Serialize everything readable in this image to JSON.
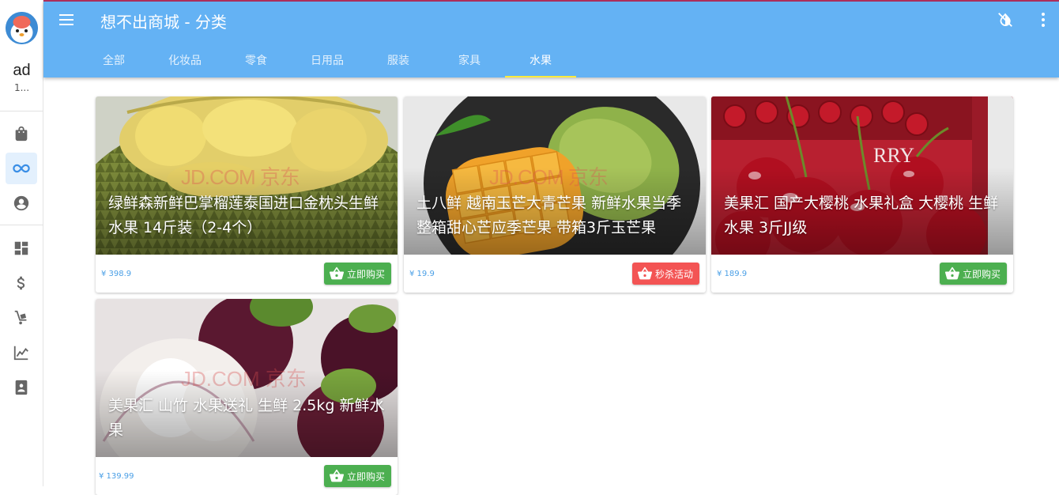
{
  "app": {
    "title": "想不出商城 - 分类"
  },
  "user": {
    "name": "ad",
    "sub": "1..."
  },
  "tabs": [
    {
      "label": "全部"
    },
    {
      "label": "化妆品"
    },
    {
      "label": "零食"
    },
    {
      "label": "日用品"
    },
    {
      "label": "服装"
    },
    {
      "label": "家具"
    },
    {
      "label": "水果"
    }
  ],
  "active_tab": "水果",
  "nav_icons": [
    "shopping-bag-icon",
    "infinity-icon",
    "account-icon",
    "dashboard-icon",
    "dollar-icon",
    "cart-dolly-icon",
    "trend-chart-icon",
    "badge-icon"
  ],
  "colors": {
    "appbar": "#64b2f4",
    "buy": "#4caf50",
    "flash": "#f35454",
    "price": "#4a9fe6",
    "tab_indicator": "#ffeb3b"
  },
  "products": [
    {
      "title": "绿鲜森新鲜巴掌榴莲泰国进口金枕头生鲜水果 14斤装（2-4个）",
      "price": "¥ 398.9",
      "button": "立即购买",
      "watermark": "JD.COM 京东"
    },
    {
      "title": "土八鲜 越南玉芒大青芒果 新鲜水果当季整箱甜心芒应季芒果 带箱3斤玉芒果",
      "price": "¥ 19.9",
      "button": "秒杀活动",
      "watermark": "JD.COM 京东"
    },
    {
      "title": "美果汇 国产大樱桃 水果礼盒 大樱桃 生鲜水果 3斤JJ级",
      "price": "¥ 189.9",
      "button": "立即购买",
      "watermark": "RRY"
    },
    {
      "title": "美果汇 山竹 水果送礼 生鲜 2.5kg 新鲜水果",
      "price": "¥ 139.99",
      "button": "立即购买",
      "watermark": "JD.COM 京东"
    }
  ]
}
